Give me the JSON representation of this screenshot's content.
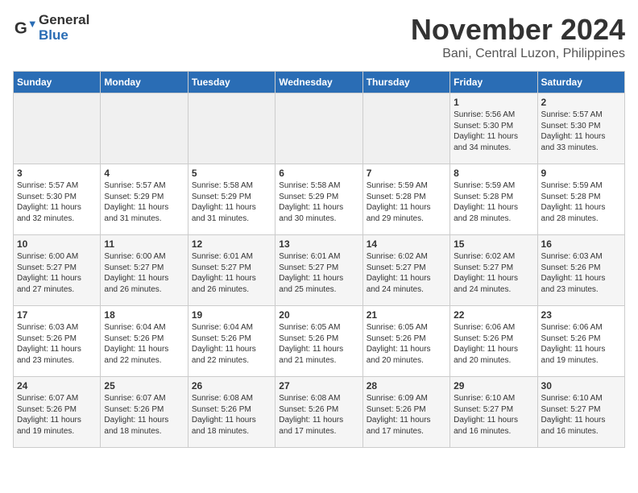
{
  "header": {
    "logo_general": "General",
    "logo_blue": "Blue",
    "month": "November 2024",
    "location": "Bani, Central Luzon, Philippines"
  },
  "weekdays": [
    "Sunday",
    "Monday",
    "Tuesday",
    "Wednesday",
    "Thursday",
    "Friday",
    "Saturday"
  ],
  "weeks": [
    [
      {
        "day": "",
        "info": ""
      },
      {
        "day": "",
        "info": ""
      },
      {
        "day": "",
        "info": ""
      },
      {
        "day": "",
        "info": ""
      },
      {
        "day": "",
        "info": ""
      },
      {
        "day": "1",
        "info": "Sunrise: 5:56 AM\nSunset: 5:30 PM\nDaylight: 11 hours\nand 34 minutes."
      },
      {
        "day": "2",
        "info": "Sunrise: 5:57 AM\nSunset: 5:30 PM\nDaylight: 11 hours\nand 33 minutes."
      }
    ],
    [
      {
        "day": "3",
        "info": "Sunrise: 5:57 AM\nSunset: 5:30 PM\nDaylight: 11 hours\nand 32 minutes."
      },
      {
        "day": "4",
        "info": "Sunrise: 5:57 AM\nSunset: 5:29 PM\nDaylight: 11 hours\nand 31 minutes."
      },
      {
        "day": "5",
        "info": "Sunrise: 5:58 AM\nSunset: 5:29 PM\nDaylight: 11 hours\nand 31 minutes."
      },
      {
        "day": "6",
        "info": "Sunrise: 5:58 AM\nSunset: 5:29 PM\nDaylight: 11 hours\nand 30 minutes."
      },
      {
        "day": "7",
        "info": "Sunrise: 5:59 AM\nSunset: 5:28 PM\nDaylight: 11 hours\nand 29 minutes."
      },
      {
        "day": "8",
        "info": "Sunrise: 5:59 AM\nSunset: 5:28 PM\nDaylight: 11 hours\nand 28 minutes."
      },
      {
        "day": "9",
        "info": "Sunrise: 5:59 AM\nSunset: 5:28 PM\nDaylight: 11 hours\nand 28 minutes."
      }
    ],
    [
      {
        "day": "10",
        "info": "Sunrise: 6:00 AM\nSunset: 5:27 PM\nDaylight: 11 hours\nand 27 minutes."
      },
      {
        "day": "11",
        "info": "Sunrise: 6:00 AM\nSunset: 5:27 PM\nDaylight: 11 hours\nand 26 minutes."
      },
      {
        "day": "12",
        "info": "Sunrise: 6:01 AM\nSunset: 5:27 PM\nDaylight: 11 hours\nand 26 minutes."
      },
      {
        "day": "13",
        "info": "Sunrise: 6:01 AM\nSunset: 5:27 PM\nDaylight: 11 hours\nand 25 minutes."
      },
      {
        "day": "14",
        "info": "Sunrise: 6:02 AM\nSunset: 5:27 PM\nDaylight: 11 hours\nand 24 minutes."
      },
      {
        "day": "15",
        "info": "Sunrise: 6:02 AM\nSunset: 5:27 PM\nDaylight: 11 hours\nand 24 minutes."
      },
      {
        "day": "16",
        "info": "Sunrise: 6:03 AM\nSunset: 5:26 PM\nDaylight: 11 hours\nand 23 minutes."
      }
    ],
    [
      {
        "day": "17",
        "info": "Sunrise: 6:03 AM\nSunset: 5:26 PM\nDaylight: 11 hours\nand 23 minutes."
      },
      {
        "day": "18",
        "info": "Sunrise: 6:04 AM\nSunset: 5:26 PM\nDaylight: 11 hours\nand 22 minutes."
      },
      {
        "day": "19",
        "info": "Sunrise: 6:04 AM\nSunset: 5:26 PM\nDaylight: 11 hours\nand 22 minutes."
      },
      {
        "day": "20",
        "info": "Sunrise: 6:05 AM\nSunset: 5:26 PM\nDaylight: 11 hours\nand 21 minutes."
      },
      {
        "day": "21",
        "info": "Sunrise: 6:05 AM\nSunset: 5:26 PM\nDaylight: 11 hours\nand 20 minutes."
      },
      {
        "day": "22",
        "info": "Sunrise: 6:06 AM\nSunset: 5:26 PM\nDaylight: 11 hours\nand 20 minutes."
      },
      {
        "day": "23",
        "info": "Sunrise: 6:06 AM\nSunset: 5:26 PM\nDaylight: 11 hours\nand 19 minutes."
      }
    ],
    [
      {
        "day": "24",
        "info": "Sunrise: 6:07 AM\nSunset: 5:26 PM\nDaylight: 11 hours\nand 19 minutes."
      },
      {
        "day": "25",
        "info": "Sunrise: 6:07 AM\nSunset: 5:26 PM\nDaylight: 11 hours\nand 18 minutes."
      },
      {
        "day": "26",
        "info": "Sunrise: 6:08 AM\nSunset: 5:26 PM\nDaylight: 11 hours\nand 18 minutes."
      },
      {
        "day": "27",
        "info": "Sunrise: 6:08 AM\nSunset: 5:26 PM\nDaylight: 11 hours\nand 17 minutes."
      },
      {
        "day": "28",
        "info": "Sunrise: 6:09 AM\nSunset: 5:26 PM\nDaylight: 11 hours\nand 17 minutes."
      },
      {
        "day": "29",
        "info": "Sunrise: 6:10 AM\nSunset: 5:27 PM\nDaylight: 11 hours\nand 16 minutes."
      },
      {
        "day": "30",
        "info": "Sunrise: 6:10 AM\nSunset: 5:27 PM\nDaylight: 11 hours\nand 16 minutes."
      }
    ]
  ]
}
